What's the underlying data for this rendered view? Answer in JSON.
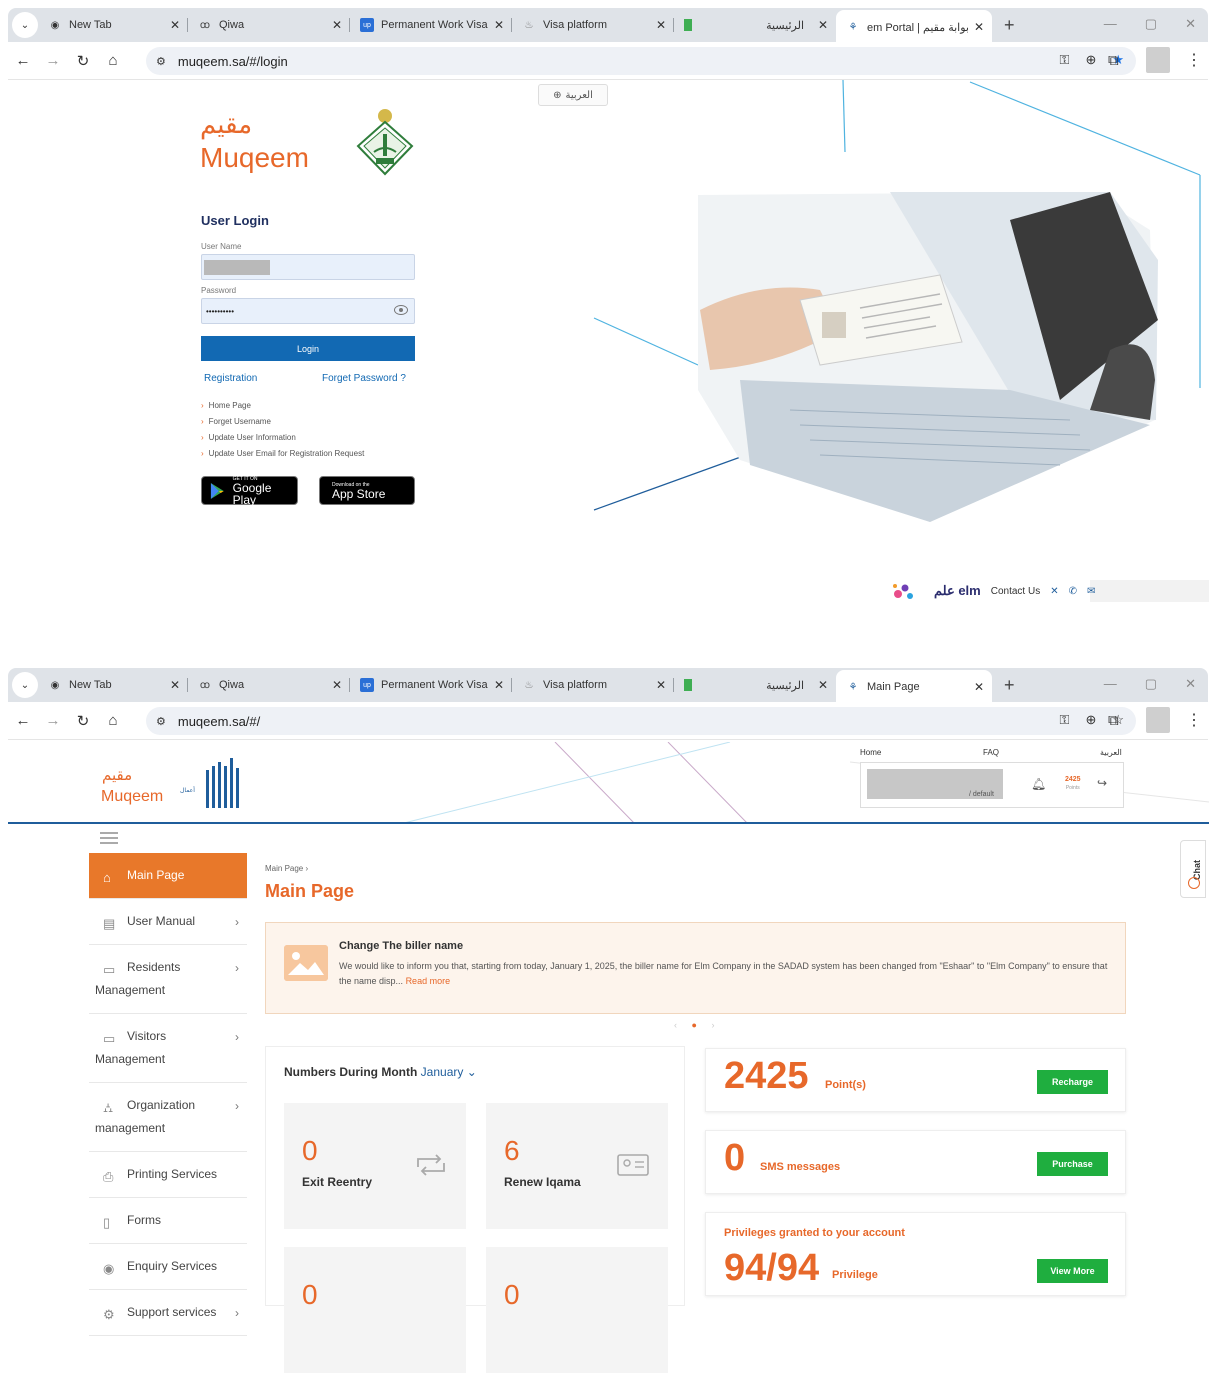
{
  "browser1": {
    "tabs": [
      {
        "label": "New Tab",
        "icon": "chrome-icon"
      },
      {
        "label": "Qiwa",
        "icon": "qiwa-icon"
      },
      {
        "label": "Permanent Work Visa",
        "icon": "up-icon"
      },
      {
        "label": "Visa platform",
        "icon": "visa-icon"
      },
      {
        "label": "الرئيسية",
        "icon": "green-icon"
      },
      {
        "label": "em Portal | بوابة مقيم",
        "icon": "muqeem-icon"
      }
    ],
    "url": "muqeem.sa/#/login"
  },
  "browser2": {
    "tabs": [
      {
        "label": "New Tab",
        "icon": "chrome-icon"
      },
      {
        "label": "Qiwa",
        "icon": "qiwa-icon"
      },
      {
        "label": "Permanent Work Visa",
        "icon": "up-icon"
      },
      {
        "label": "Visa platform",
        "icon": "visa-icon"
      },
      {
        "label": "الرئيسية",
        "icon": "green-icon"
      },
      {
        "label": "Main Page",
        "icon": "muqeem-icon"
      }
    ],
    "url": "muqeem.sa/#/"
  },
  "login": {
    "lang_button": "العربية",
    "logo_ar": "مقيم",
    "logo_en": "Muqeem",
    "title": "User Login",
    "username_label": "User Name",
    "password_label": "Password",
    "password_value": "••••••••••",
    "login_button": "Login",
    "registration": "Registration",
    "forget_password": "Forget Password ?",
    "links": [
      "Home Page",
      "Forget Username",
      "Update User Information",
      "Update User Email for Registration Request"
    ],
    "google_play_small": "GET IT ON",
    "google_play_big": "Google Play",
    "app_store_small": "Download on the",
    "app_store_big": "App Store",
    "footer_brand": "علم elm",
    "contact_us": "Contact Us"
  },
  "main": {
    "logo_ar": "مقيم",
    "logo_en": "Muqeem",
    "top_links": {
      "home": "Home",
      "faq": "FAQ",
      "lang": "العربية"
    },
    "user_role": "/ default",
    "points_mini": "2425",
    "points_mini_label": "Points",
    "sidebar": [
      {
        "label": "Main Page",
        "icon": "home-icon"
      },
      {
        "label": "User Manual",
        "icon": "book-icon"
      },
      {
        "label": "Residents",
        "label2": "Management",
        "icon": "id-card-icon"
      },
      {
        "label": "Visitors",
        "label2": "Management",
        "icon": "visitor-card-icon"
      },
      {
        "label": "Organization",
        "label2": "management",
        "icon": "org-chart-icon"
      },
      {
        "label": "Printing Services",
        "icon": "printer-icon"
      },
      {
        "label": "Forms",
        "icon": "document-icon"
      },
      {
        "label": "Enquiry Services",
        "icon": "eye-icon"
      },
      {
        "label": "Support services",
        "icon": "support-icon"
      }
    ],
    "breadcrumb": "Main Page",
    "page_title": "Main Page",
    "notice": {
      "title": "Change The biller name",
      "text": "We would like to inform you that, starting from today, January 1, 2025, the biller name for Elm Company in the SADAD system has been changed from \"Eshaar\" to \"Elm Company\" to ensure that the name disp...",
      "read_more": "Read more"
    },
    "numbers": {
      "heading": "Numbers During Month",
      "month": "January",
      "stats": [
        {
          "value": "0",
          "label": "Exit Reentry"
        },
        {
          "value": "6",
          "label": "Renew Iqama"
        },
        {
          "value": "0",
          "label": ""
        },
        {
          "value": "0",
          "label": ""
        }
      ]
    },
    "points": {
      "value": "2425",
      "unit": "Point(s)",
      "button": "Recharge"
    },
    "sms": {
      "value": "0",
      "unit": "SMS messages",
      "button": "Purchase"
    },
    "privileges": {
      "title": "Privileges granted to your account",
      "value": "94/94",
      "unit": "Privilege",
      "button": "View More"
    },
    "chat": "Chat"
  },
  "colors": {
    "accent": "#e7682a",
    "primary": "#1269b3",
    "green": "#1fae3f"
  }
}
